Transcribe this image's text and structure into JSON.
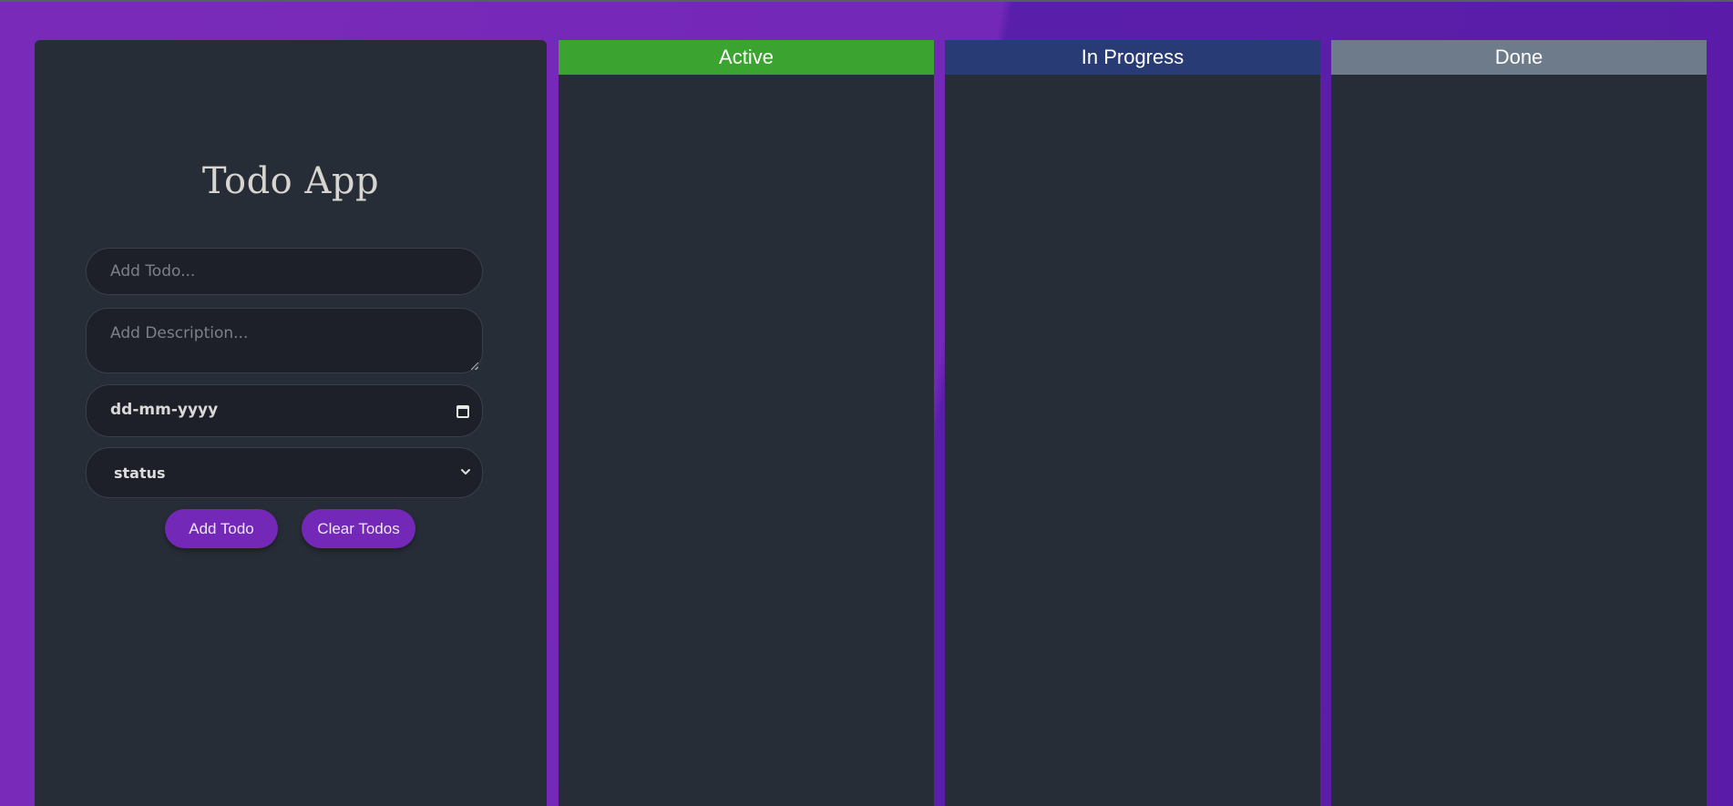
{
  "app": {
    "title": "Todo App"
  },
  "form": {
    "todo_placeholder": "Add Todo...",
    "description_placeholder": "Add Description...",
    "date_value": "dd-mm-yyyy",
    "status_value": "status",
    "add_button": "Add Todo",
    "clear_button": "Clear Todos"
  },
  "columns": [
    {
      "label": "Active",
      "color": "#3ba32f"
    },
    {
      "label": "In Progress",
      "color": "#283b74"
    },
    {
      "label": "Done",
      "color": "#6e7b8b"
    }
  ],
  "colors": {
    "accent": "#7328b7",
    "panel": "#272d37",
    "input_bg": "#1d2028"
  },
  "icons": {
    "date_picker": "calendar-icon",
    "status_dropdown": "chevron-down-icon"
  }
}
